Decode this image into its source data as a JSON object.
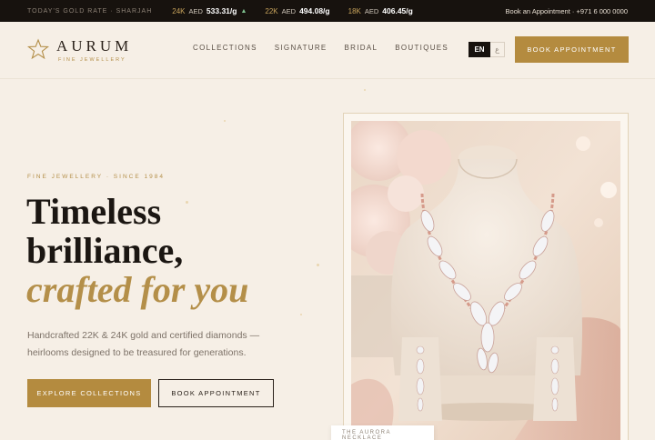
{
  "ticker": {
    "label": "TODAY'S GOLD RATE · SHARJAH",
    "rates": [
      {
        "karat": "24K",
        "currency": "AED",
        "value": "533.31/g",
        "trend": "▲"
      },
      {
        "karat": "22K",
        "currency": "AED",
        "value": "494.08/g"
      },
      {
        "karat": "18K",
        "currency": "AED",
        "value": "406.45/g"
      }
    ],
    "contact": "Book an Appointment · +971 6 000 0000"
  },
  "brand": {
    "name": "AURUM",
    "tagline": "FINE JEWELLERY"
  },
  "nav": [
    "COLLECTIONS",
    "SIGNATURE",
    "BRIDAL",
    "BOUTIQUES"
  ],
  "lang": {
    "active": "EN",
    "inactive": "ع"
  },
  "header_cta": "BOOK APPOINTMENT",
  "hero": {
    "eyebrow": "FINE JEWELLERY · SINCE 1984",
    "headline_line1": "Timeless",
    "headline_line2": "brilliance,",
    "headline_line3": "crafted for you",
    "lead": "Handcrafted 22K & 24K gold and certified diamonds — heirlooms designed to be treasured for generations.",
    "primary_cta": "EXPLORE COLLECTIONS",
    "secondary_cta": "BOOK APPOINTMENT"
  },
  "feature": {
    "caption": "THE AURORA NECKLACE"
  },
  "colors": {
    "gold": "#b48b3f",
    "dark": "#17120e",
    "cream": "#f6efe6"
  }
}
